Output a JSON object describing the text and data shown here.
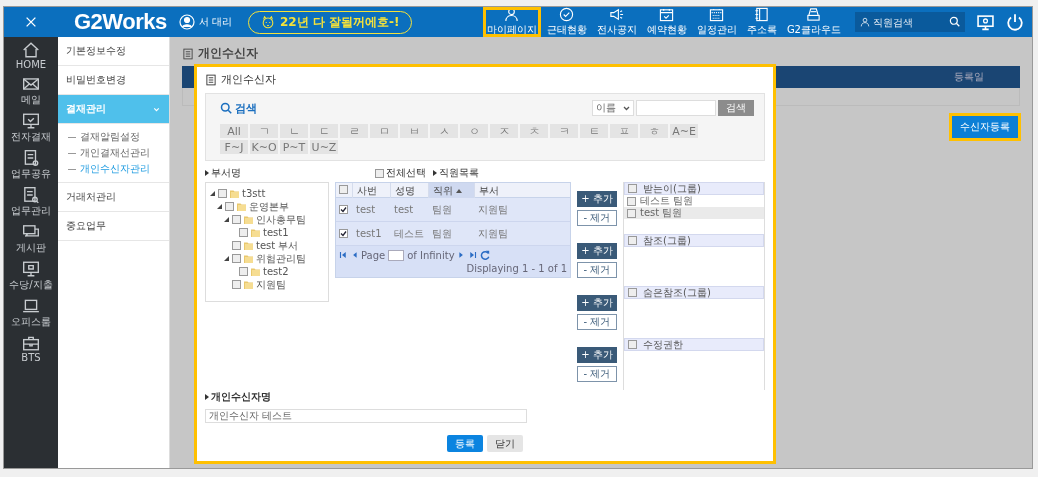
{
  "top_bar": {
    "logo": "G2Works",
    "user": "서 대리",
    "banner": "22년 다 잘될꺼에호-!",
    "nav": [
      {
        "label": "마이페이지",
        "highlighted": true
      },
      {
        "label": "근태현황",
        "highlighted": false
      },
      {
        "label": "전사공지",
        "highlighted": false
      },
      {
        "label": "예약현황",
        "highlighted": false
      },
      {
        "label": "일정관리",
        "highlighted": false
      },
      {
        "label": "주소록",
        "highlighted": false
      },
      {
        "label": "G2클라우드",
        "highlighted": false
      }
    ],
    "search": {
      "placeholder": "직원검색"
    }
  },
  "rail": [
    {
      "label": "HOME"
    },
    {
      "label": "메일"
    },
    {
      "label": "전자결재"
    },
    {
      "label": "업무공유"
    },
    {
      "label": "업무관리"
    },
    {
      "label": "게시판"
    },
    {
      "label": "수당/지출"
    },
    {
      "label": "오피스룸"
    },
    {
      "label": "BTS"
    }
  ],
  "sidebar": {
    "items": [
      {
        "label": "기본정보수정",
        "selected": false
      },
      {
        "label": "비밀번호변경",
        "selected": false
      },
      {
        "label": "결재관리",
        "selected": true,
        "expanded": true,
        "children": [
          {
            "label": "결재알림설정",
            "selected": false
          },
          {
            "label": "개인결재선관리",
            "selected": false
          },
          {
            "label": "개인수신자관리",
            "selected": true
          }
        ]
      },
      {
        "label": "거래처관리",
        "selected": false
      },
      {
        "label": "중요업무",
        "selected": false
      }
    ]
  },
  "page": {
    "title": "개인수신자",
    "table": {
      "columns": [
        "등록일"
      ]
    },
    "button": {
      "label": "수신자등록",
      "highlighted": true
    }
  },
  "dialog": {
    "title": "개인수신자",
    "search": {
      "title": "검색",
      "field_select": "이름",
      "button": "검색",
      "letters": [
        "All",
        "ㄱ",
        "ㄴ",
        "ㄷ",
        "ㄹ",
        "ㅁ",
        "ㅂ",
        "ㅅ",
        "ㅇ",
        "ㅈ",
        "ㅊ",
        "ㅋ",
        "ㅌ",
        "ㅍ",
        "ㅎ",
        "A~E",
        "F~J",
        "K~O",
        "P~T",
        "U~Z"
      ]
    },
    "tree_label": "부서명",
    "select_all": {
      "label": "전체선택",
      "checked": false
    },
    "list_label": "직원목록",
    "tree": [
      {
        "label": "t3stt",
        "checked": false,
        "expanded": true,
        "children": [
          {
            "label": "운영본부",
            "checked": false,
            "expanded": true,
            "children": [
              {
                "label": "인사총무팀",
                "checked": false,
                "expanded": true,
                "children": [
                  {
                    "label": "test1",
                    "checked": false
                  }
                ]
              },
              {
                "label": "test 부서",
                "checked": false
              },
              {
                "label": "위험관리팀",
                "checked": false,
                "expanded": true,
                "children": [
                  {
                    "label": "test2",
                    "checked": false
                  }
                ]
              },
              {
                "label": "지원팀",
                "checked": false
              }
            ]
          }
        ]
      }
    ],
    "grid": {
      "header_checked": false,
      "columns": [
        {
          "label": "사번",
          "sorted": false
        },
        {
          "label": "성명",
          "sorted": false
        },
        {
          "label": "직위",
          "sorted": true
        },
        {
          "label": "부서",
          "sorted": false
        }
      ],
      "rows": [
        {
          "checked": true,
          "cells": [
            "test",
            "test",
            "팀원",
            "지원팀"
          ]
        },
        {
          "checked": true,
          "cells": [
            "test1",
            "테스트",
            "팀원",
            "지원팀"
          ]
        }
      ],
      "pager": {
        "page_label": "Page",
        "of_label": "of Infinity",
        "info": "Displaying 1 - 1  of 1"
      }
    },
    "groups": [
      {
        "title": "받는이(그룹)",
        "header_checked": false,
        "add_button": "+ 추가",
        "remove_button": "- 제거",
        "items": [
          {
            "label": "테스트 팀원",
            "checked": false,
            "selected": false
          },
          {
            "label": "test 팀원",
            "checked": false,
            "selected": true
          }
        ]
      },
      {
        "title": "참조(그룹)",
        "header_checked": false,
        "add_button": "+ 추가",
        "remove_button": "- 제거"
      },
      {
        "title": "숨은참조(그룹)",
        "header_checked": false,
        "add_button": "+ 추가",
        "remove_button": "- 제거"
      },
      {
        "title": "수정권한",
        "header_checked": false,
        "add_button": "+ 추가",
        "remove_button": "- 제거"
      }
    ],
    "name_label": "개인수신자명",
    "name_value": "개인수신자 테스트",
    "buttons": [
      {
        "label": "등록",
        "kind": "primary"
      },
      {
        "label": "닫기",
        "kind": "secondary"
      }
    ]
  }
}
